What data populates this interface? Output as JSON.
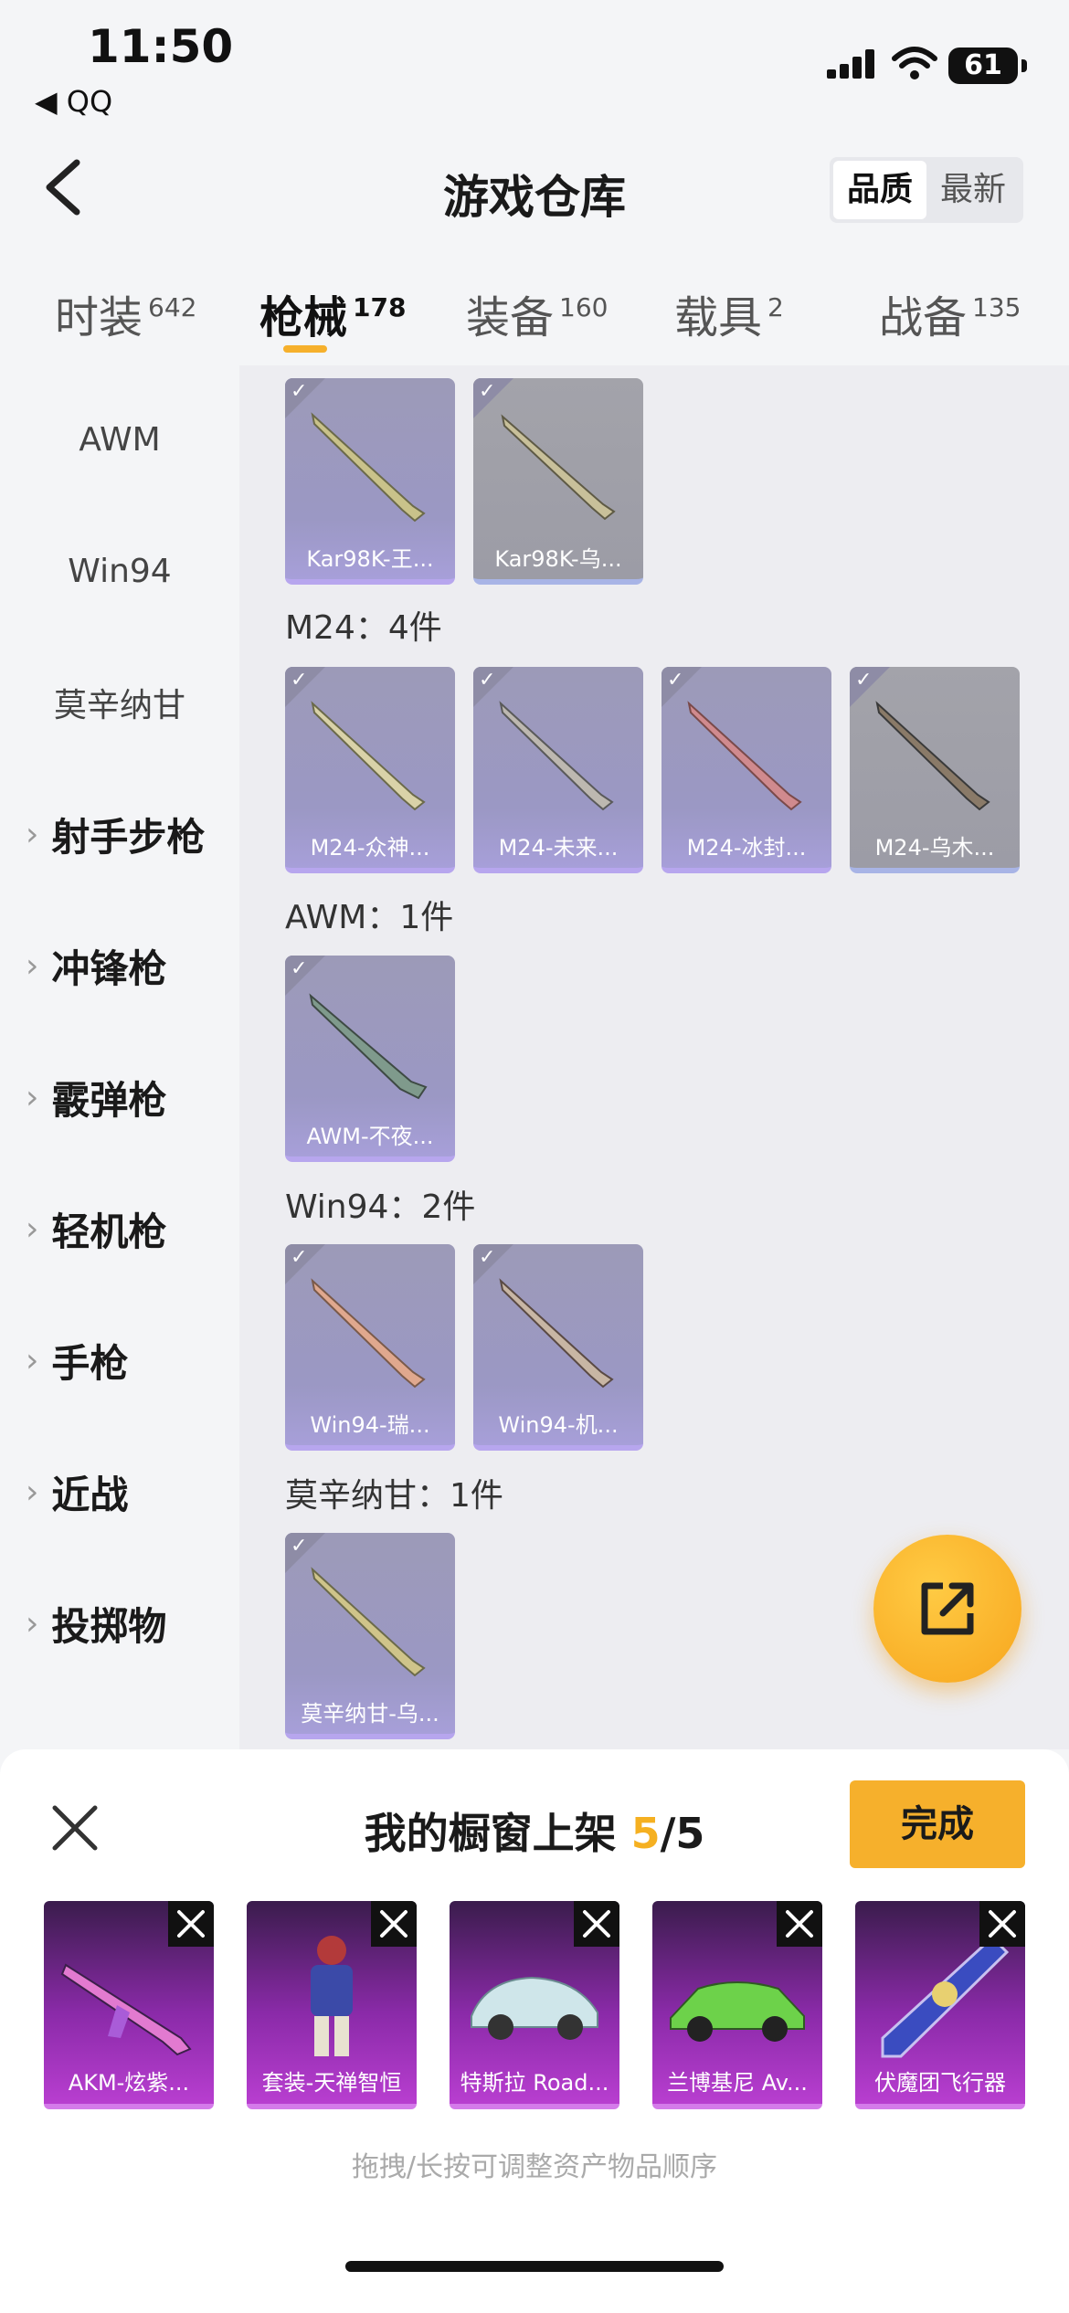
{
  "status_bar": {
    "time": "11:50",
    "back_app": "◀ QQ",
    "battery": "61"
  },
  "header": {
    "title": "游戏仓库",
    "sort_options": [
      "品质",
      "最新"
    ]
  },
  "tabs": [
    {
      "label": "时装",
      "count": "642"
    },
    {
      "label": "枪械",
      "count": "178"
    },
    {
      "label": "装备",
      "count": "160"
    },
    {
      "label": "载具",
      "count": "2"
    },
    {
      "label": "战备",
      "count": "135"
    }
  ],
  "sidebar": {
    "subitems": [
      "AWM",
      "Win94",
      "莫辛纳甘"
    ],
    "groups": [
      "射手步枪",
      "冲锋枪",
      "霰弹枪",
      "轻机枪",
      "手枪",
      "近战",
      "投掷物"
    ]
  },
  "main": {
    "sections": [
      {
        "label": "",
        "items": [
          "Kar98K-王...",
          "Kar98K-乌..."
        ]
      },
      {
        "label": "M24：4件",
        "items": [
          "M24-众神...",
          "M24-未来...",
          "M24-冰封...",
          "M24-乌木..."
        ]
      },
      {
        "label": "AWM：1件",
        "items": [
          "AWM-不夜..."
        ]
      },
      {
        "label": "Win94：2件",
        "items": [
          "Win94-瑞...",
          "Win94-机..."
        ]
      },
      {
        "label": "莫辛纳甘：1件",
        "items": [
          "莫辛纳甘-乌..."
        ]
      }
    ]
  },
  "sheet": {
    "title": "我的橱窗上架",
    "count_current": "5",
    "count_total": "/5",
    "done_label": "完成",
    "items": [
      "AKM-炫紫...",
      "套装-天禅智恒",
      "特斯拉 Road...",
      "兰博基尼 Av...",
      "伏魔团飞行器"
    ],
    "hint": "拖拽/长按可调整资产物品顺序"
  },
  "colors": {
    "accent": "#f6b02c",
    "card_purple": "#9b98c4",
    "shelf_purple": "#8a2aa8"
  }
}
